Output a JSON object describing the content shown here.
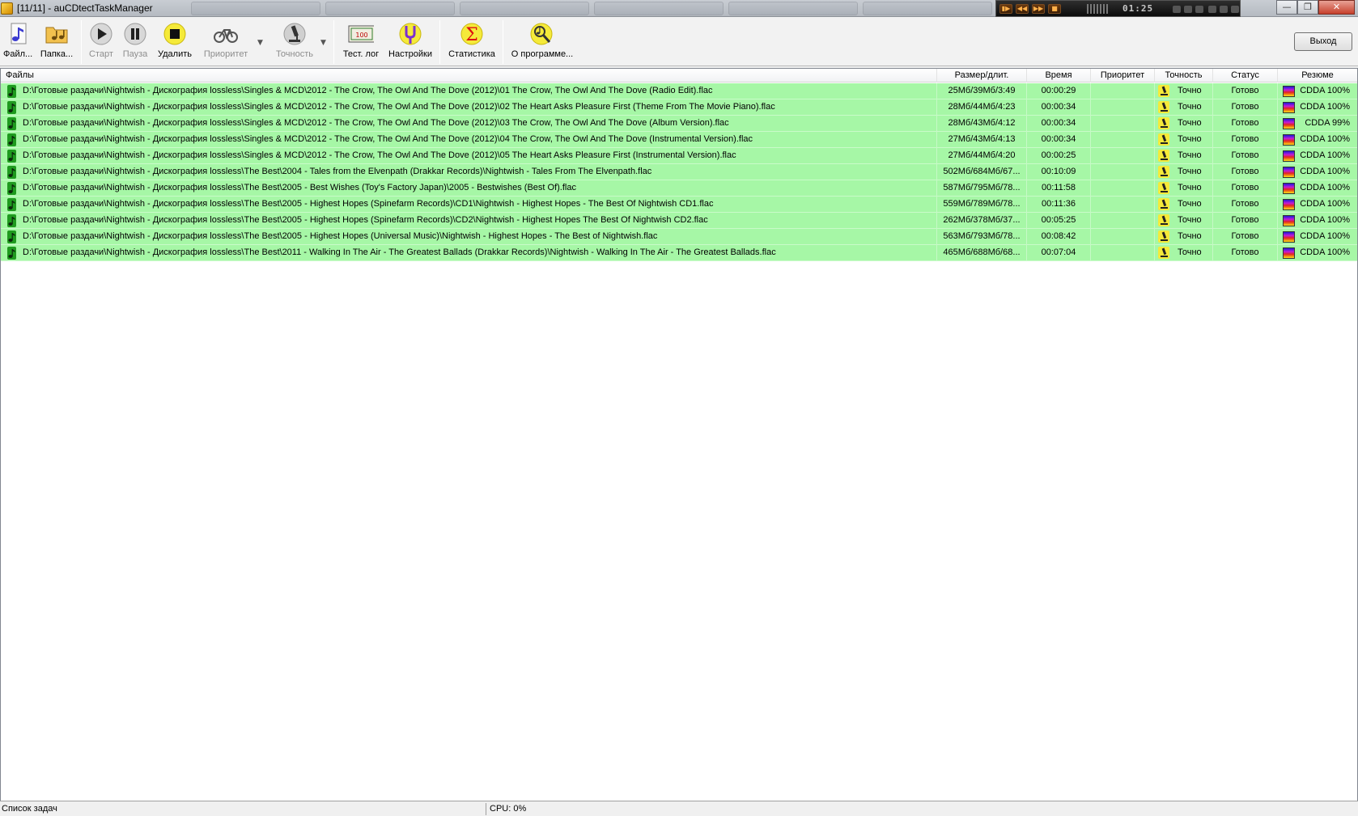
{
  "window": {
    "title": "[11/11] - auCDtectTaskManager",
    "minimize": "—",
    "maximize": "❐",
    "close": "✕"
  },
  "mini_player": {
    "time": "01:25"
  },
  "toolbar": {
    "files_label": "Файл...",
    "folder_label": "Папка...",
    "start_label": "Старт",
    "pause_label": "Пауза",
    "delete_label": "Удалить",
    "priority_label": "Приоритет",
    "accuracy_label": "Точность",
    "testlog_label": "Тест. лог",
    "settings_label": "Настройки",
    "statistics_label": "Статистика",
    "about_label": "О программе...",
    "exit_label": "Выход"
  },
  "table": {
    "columns": {
      "files": "Файлы",
      "size": "Размер/длит.",
      "time": "Время",
      "priority": "Приоритет",
      "accuracy": "Точность",
      "status": "Статус",
      "result": "Резюме"
    },
    "rows": [
      {
        "file": "D:\\Готовые раздачи\\Nightwish - Дискография lossless\\Singles & MCD\\2012 - The Crow, The Owl And The Dove (2012)\\01 The Crow, The Owl And The Dove (Radio Edit).flac",
        "size": "25Мб/39Мб/3:49",
        "time": "00:00:29",
        "priority": "",
        "accuracy": "Точно",
        "status": "Готово",
        "result": "CDDA 100%"
      },
      {
        "file": "D:\\Готовые раздачи\\Nightwish - Дискография lossless\\Singles & MCD\\2012 - The Crow, The Owl And The Dove (2012)\\02 The Heart Asks Pleasure First (Theme From The Movie Piano).flac",
        "size": "28Мб/44Мб/4:23",
        "time": "00:00:34",
        "priority": "",
        "accuracy": "Точно",
        "status": "Готово",
        "result": "CDDA 100%"
      },
      {
        "file": "D:\\Готовые раздачи\\Nightwish - Дискография lossless\\Singles & MCD\\2012 - The Crow, The Owl And The Dove (2012)\\03 The Crow, The Owl And The Dove (Album Version).flac",
        "size": "28Мб/43Мб/4:12",
        "time": "00:00:34",
        "priority": "",
        "accuracy": "Точно",
        "status": "Готово",
        "result": "CDDA 99%"
      },
      {
        "file": "D:\\Готовые раздачи\\Nightwish - Дискография lossless\\Singles & MCD\\2012 - The Crow, The Owl And The Dove (2012)\\04 The Crow, The Owl And The Dove (Instrumental Version).flac",
        "size": "27Мб/43Мб/4:13",
        "time": "00:00:34",
        "priority": "",
        "accuracy": "Точно",
        "status": "Готово",
        "result": "CDDA 100%"
      },
      {
        "file": "D:\\Готовые раздачи\\Nightwish - Дискография lossless\\Singles & MCD\\2012 - The Crow, The Owl And The Dove (2012)\\05 The Heart Asks Pleasure First (Instrumental Version).flac",
        "size": "27Мб/44Мб/4:20",
        "time": "00:00:25",
        "priority": "",
        "accuracy": "Точно",
        "status": "Готово",
        "result": "CDDA 100%"
      },
      {
        "file": "D:\\Готовые раздачи\\Nightwish - Дискография lossless\\The Best\\2004 - Tales from the Elvenpath (Drakkar Records)\\Nightwish - Tales From The Elvenpath.flac",
        "size": "502Мб/684Мб/67...",
        "time": "00:10:09",
        "priority": "",
        "accuracy": "Точно",
        "status": "Готово",
        "result": "CDDA 100%"
      },
      {
        "file": "D:\\Готовые раздачи\\Nightwish - Дискография lossless\\The Best\\2005 - Best Wishes (Toy's Factory Japan)\\2005 - Bestwishes (Best Of).flac",
        "size": "587Мб/795Мб/78...",
        "time": "00:11:58",
        "priority": "",
        "accuracy": "Точно",
        "status": "Готово",
        "result": "CDDA 100%"
      },
      {
        "file": "D:\\Готовые раздачи\\Nightwish - Дискография lossless\\The Best\\2005 - Highest Hopes (Spinefarm Records)\\CD1\\Nightwish - Highest Hopes - The Best Of Nightwish CD1.flac",
        "size": "559Мб/789Мб/78...",
        "time": "00:11:36",
        "priority": "",
        "accuracy": "Точно",
        "status": "Готово",
        "result": "CDDA 100%"
      },
      {
        "file": "D:\\Готовые раздачи\\Nightwish - Дискография lossless\\The Best\\2005 - Highest Hopes (Spinefarm Records)\\CD2\\Nightwish - Highest Hopes  The Best Of Nightwish CD2.flac",
        "size": "262Мб/378Мб/37...",
        "time": "00:05:25",
        "priority": "",
        "accuracy": "Точно",
        "status": "Готово",
        "result": "CDDA 100%"
      },
      {
        "file": "D:\\Готовые раздачи\\Nightwish - Дискография lossless\\The Best\\2005 - Highest Hopes (Universal Music)\\Nightwish - Highest Hopes - The Best of Nightwish.flac",
        "size": "563Мб/793Мб/78...",
        "time": "00:08:42",
        "priority": "",
        "accuracy": "Точно",
        "status": "Готово",
        "result": "CDDA 100%"
      },
      {
        "file": "D:\\Готовые раздачи\\Nightwish - Дискография lossless\\The Best\\2011 - Walking In The Air - The Greatest Ballads (Drakkar Records)\\Nightwish - Walking In The Air - The Greatest Ballads.flac",
        "size": "465Мб/688Мб/68...",
        "time": "00:07:04",
        "priority": "",
        "accuracy": "Точно",
        "status": "Готово",
        "result": "CDDA 100%"
      }
    ]
  },
  "statusbar": {
    "left": "Список задач",
    "cpu": "CPU: 0%"
  }
}
